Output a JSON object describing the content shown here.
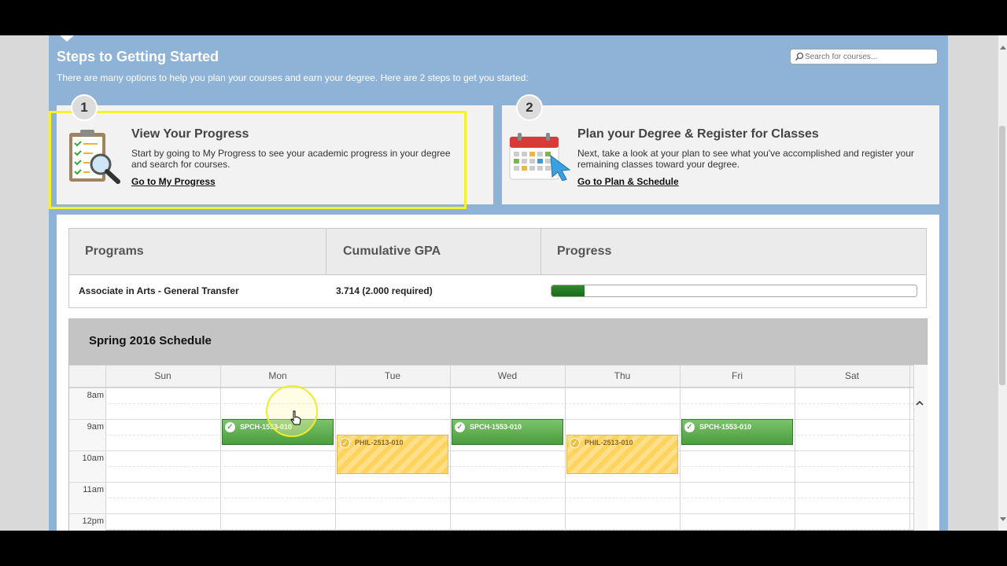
{
  "header": {
    "title": "Steps to Getting Started",
    "subtitle": "There are many options to help you plan your courses and earn your degree. Here are 2 steps to get you started:",
    "search_placeholder": "Search for courses..."
  },
  "steps": [
    {
      "number": "1",
      "title": "View Your Progress",
      "text": "Start by going to My Progress to see your academic progress in your degree and search for courses.",
      "link": "Go to My Progress",
      "icon": "clipboard-magnifier-icon"
    },
    {
      "number": "2",
      "title": "Plan your Degree & Register for Classes",
      "text": "Next, take a look at your plan to see what you've accomplished and register your remaining classes toward your degree.",
      "link": "Go to Plan & Schedule",
      "icon": "calendar-pointer-icon"
    }
  ],
  "programs": {
    "headers": [
      "Programs",
      "Cumulative GPA",
      "Progress"
    ],
    "row": {
      "program": "Associate in Arts - General Transfer",
      "gpa": "3.714 (2.000 required)",
      "progress_fraction": 0.09
    }
  },
  "schedule": {
    "title": "Spring 2016 Schedule",
    "days": [
      "Sun",
      "Mon",
      "Tue",
      "Wed",
      "Thu",
      "Fri",
      "Sat"
    ],
    "times": [
      "8am",
      "9am",
      "10am",
      "11am",
      "12pm"
    ],
    "events": [
      {
        "day": "Mon",
        "label": "SPCH-1553-010",
        "status": "registered",
        "start": "9:00",
        "end": "9:50"
      },
      {
        "day": "Tue",
        "label": "PHIL-2513-010",
        "status": "planned",
        "start": "9:30",
        "end": "10:45"
      },
      {
        "day": "Wed",
        "label": "SPCH-1553-010",
        "status": "registered",
        "start": "9:00",
        "end": "9:50"
      },
      {
        "day": "Thu",
        "label": "PHIL-2513-010",
        "status": "planned",
        "start": "9:30",
        "end": "10:45"
      },
      {
        "day": "Fri",
        "label": "SPCH-1553-010",
        "status": "registered",
        "start": "9:00",
        "end": "9:50"
      }
    ]
  },
  "colors": {
    "header_blue": "#8fb3d6",
    "highlight_yellow": "#f4f22a",
    "registered_green": "#4a9e3e",
    "planned_yellow": "#ffd35e"
  }
}
